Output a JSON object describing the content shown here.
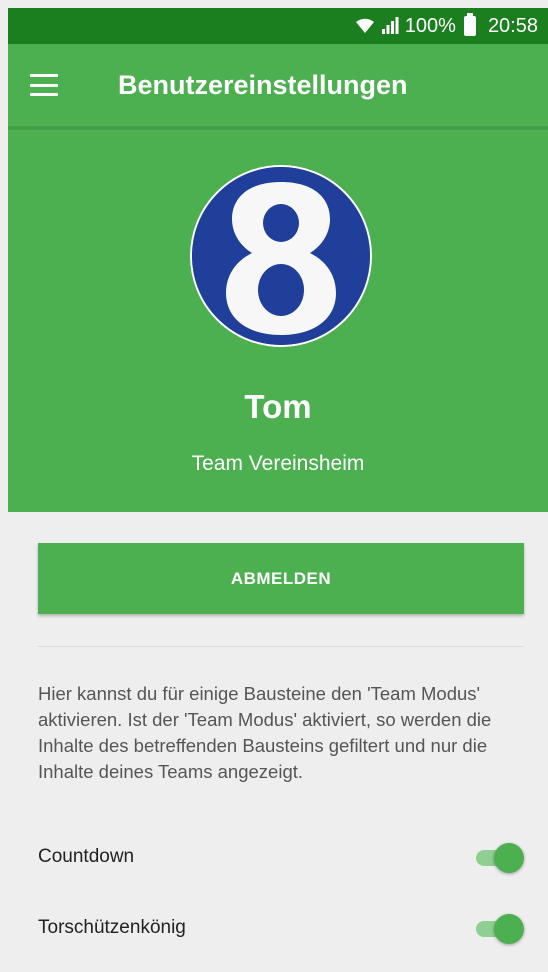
{
  "status_bar": {
    "battery_text": "100%",
    "time": "20:58",
    "icons": [
      "wifi-icon",
      "signal-icon",
      "battery-icon"
    ]
  },
  "app_bar": {
    "title": "Benutzereinstellungen",
    "menu_icon": "hamburger-menu-icon"
  },
  "profile": {
    "avatar_number": "8",
    "name": "Tom",
    "team": "Team Vereinsheim"
  },
  "actions": {
    "logout_label": "ABMELDEN"
  },
  "team_mode": {
    "description": "Hier kannst du für einige Bausteine den 'Team Modus' aktivieren. Ist der 'Team Modus' aktiviert, so werden die Inhalte des betreffenden Bausteins gefiltert und nur die Inhalte deines Teams angezeigt.",
    "toggles": [
      {
        "label": "Countdown",
        "enabled": true
      },
      {
        "label": "Torschützenkönig",
        "enabled": true
      }
    ]
  },
  "colors": {
    "status_bar": "#1b7f1f",
    "primary": "#4caf50",
    "avatar_background": "#1f3f9a",
    "background": "#eeeeee"
  }
}
